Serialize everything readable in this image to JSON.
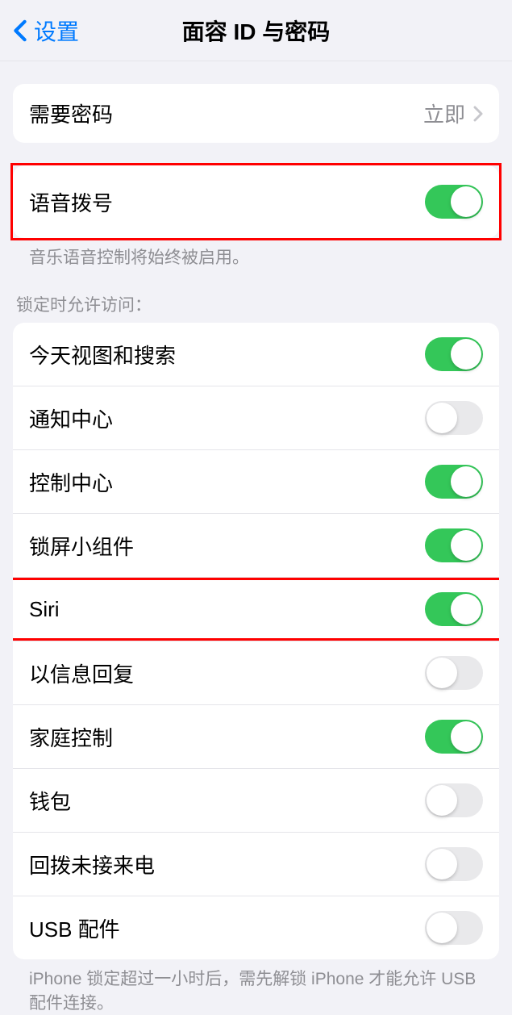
{
  "header": {
    "back_label": "设置",
    "title": "面容 ID 与密码"
  },
  "passcode_section": {
    "label": "需要密码",
    "value": "立即"
  },
  "voice_dial": {
    "label": "语音拨号",
    "enabled": true,
    "footer": "音乐语音控制将始终被启用。"
  },
  "lock_access": {
    "header": "锁定时允许访问：",
    "items": [
      {
        "label": "今天视图和搜索",
        "enabled": true
      },
      {
        "label": "通知中心",
        "enabled": false
      },
      {
        "label": "控制中心",
        "enabled": true
      },
      {
        "label": "锁屏小组件",
        "enabled": true
      },
      {
        "label": "Siri",
        "enabled": true
      },
      {
        "label": "以信息回复",
        "enabled": false
      },
      {
        "label": "家庭控制",
        "enabled": true
      },
      {
        "label": "钱包",
        "enabled": false
      },
      {
        "label": "回拨未接来电",
        "enabled": false
      },
      {
        "label": "USB 配件",
        "enabled": false
      }
    ],
    "footer": "iPhone 锁定超过一小时后，需先解锁 iPhone 才能允许 USB 配件连接。"
  }
}
